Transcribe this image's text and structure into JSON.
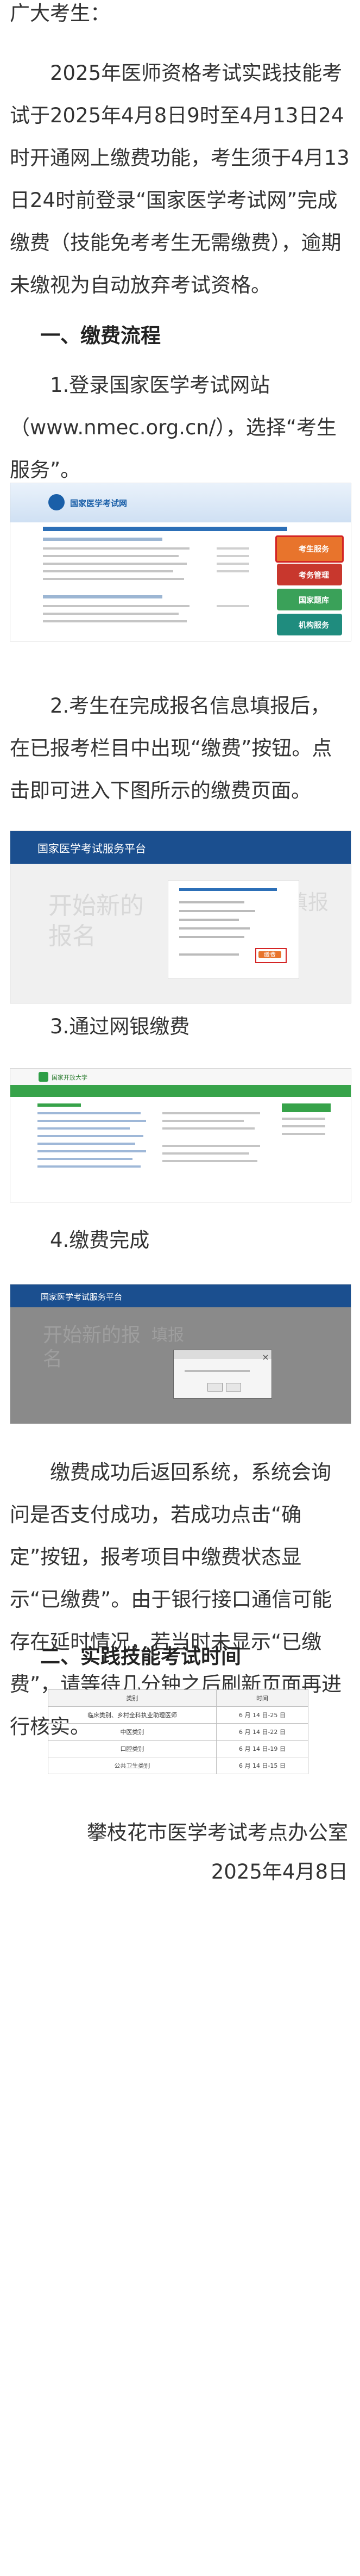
{
  "intro": {
    "greeting": "广大考生：",
    "body": "2025年医师资格考试实践技能考试于2025年4月8日9时至4月13日24时开通网上缴费功能，考生须于4月13日24时前登录“国家医学考试网”完成缴费（技能免考考生无需缴费），逾期未缴视为自动放弃考试资格。"
  },
  "section1": {
    "heading": "一、缴费流程",
    "step1": "1.登录国家医学考试网站（www.nmec.org.cn/），选择“考生服务”。",
    "step2": "2.考生在完成报名信息填报后，在已报考栏目中出现“缴费”按钮。点击即可进入下图所示的缴费页面。",
    "step3": "3.通过网银缴费",
    "step4": "4.缴费完成",
    "after": "缴费成功后返回系统，系统会询问是否支付成功，若成功点击“确定”按钮，报考项目中缴费状态显示“已缴费”。由于银行接口通信可能存在延时情况，若当时未显示“已缴费”，请等待几分钟之后刷新页面再进行核实。"
  },
  "shot1": {
    "site_name": "国家医学考试网",
    "tiles": [
      "考生服务",
      "考务管理",
      "国家题库",
      "机构服务"
    ]
  },
  "shot2": {
    "platform": "国家医学考试服务平台",
    "watermark": "开始新的报名",
    "watermark2": "填报",
    "pay_button": "缴费"
  },
  "shot3": {
    "bank": "国家开放大学"
  },
  "shot4": {
    "platform": "国家医学考试服务平台",
    "watermark": "开始新的报名",
    "watermark2": "填报"
  },
  "section2": {
    "heading": "二、实践技能考试时间",
    "table": {
      "headers": [
        "类别",
        "时间"
      ],
      "rows": [
        [
          "临床类别、乡村全科执业助理医师",
          "6 月 14 日-25 日"
        ],
        [
          "中医类别",
          "6 月 14 日-22 日"
        ],
        [
          "口腔类别",
          "6 月 14 日-19 日"
        ],
        [
          "公共卫生类别",
          "6 月 14 日-15 日"
        ]
      ]
    }
  },
  "footer": {
    "org": "攀枝花市医学考试考点办公室",
    "date": "2025年4月8日"
  },
  "colors": {
    "text": "#333333",
    "brand_blue": "#1a5fa8",
    "tile_orange": "#e8742c",
    "tile_red": "#c8372d",
    "tile_green": "#3aa159",
    "tile_teal": "#1f8c7e"
  }
}
